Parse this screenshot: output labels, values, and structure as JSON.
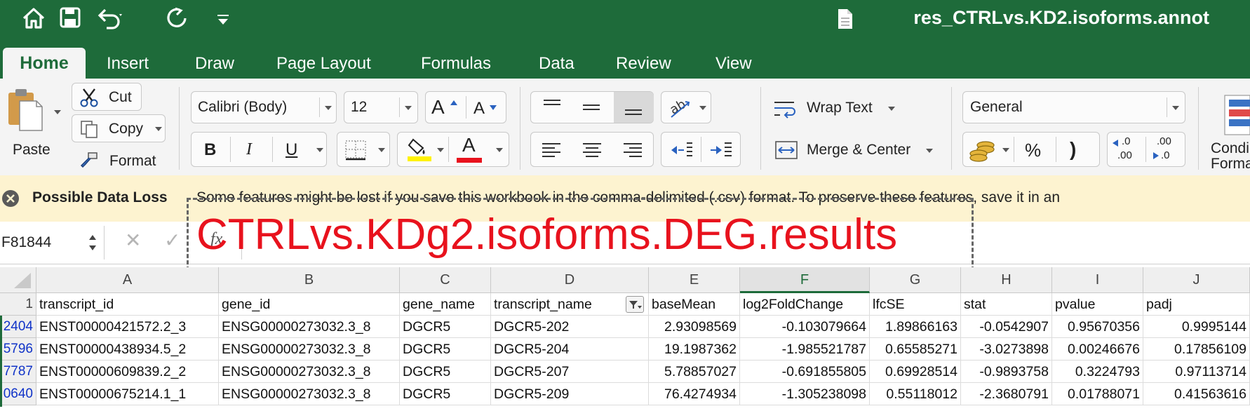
{
  "app": {
    "title": "res_CTRLvs.KD2.isoforms.annot",
    "tabs": [
      "Home",
      "Insert",
      "Draw",
      "Page Layout",
      "Formulas",
      "Data",
      "Review",
      "View"
    ],
    "active_tab": "Home",
    "accent": "#1e6b3a"
  },
  "ribbon": {
    "paste_label": "Paste",
    "cut_label": "Cut",
    "copy_label": "Copy",
    "format_label": "Format",
    "font_name": "Calibri (Body)",
    "font_size": "12",
    "bold": "B",
    "italic": "I",
    "underline": "U",
    "font_grow": "A",
    "font_shrink": "A",
    "font_color_letter": "A",
    "wrap_text_label": "Wrap Text",
    "merge_center_label": "Merge & Center",
    "number_format": "General",
    "percent": "%",
    "comma": ")",
    "inc_decimal": ".00",
    "dec_decimal": ".0",
    "conditional_label_1": "Condi",
    "conditional_label_2": "Forma"
  },
  "warning": {
    "title": "Possible Data Loss",
    "message": "Some features might be lost if you save this workbook in the comma-delimited (.csv) format. To preserve these features, save it in an"
  },
  "formula_bar": {
    "name_box": "F81844",
    "cancel": "✕",
    "confirm": "✓",
    "fx": "fx"
  },
  "overlay": {
    "text": "CTRLvs.KDg2.isoforms.DEG.results",
    "color": "#e8121d"
  },
  "columns": [
    "A",
    "B",
    "C",
    "D",
    "E",
    "F",
    "G",
    "H",
    "I",
    "J"
  ],
  "header_row": {
    "row_label": "1",
    "cells": [
      "transcript_id",
      "gene_id",
      "gene_name",
      "transcript_name",
      "baseMean",
      "log2FoldChange",
      "lfcSE",
      "stat",
      "pvalue",
      "padj"
    ]
  },
  "rows": [
    {
      "row_label": "2404",
      "cells": [
        "ENST00000421572.2_3",
        "ENSG00000273032.3_8",
        "DGCR5",
        "DGCR5-202",
        "2.93098569",
        "-0.103079664",
        "1.89866163",
        "-0.0542907",
        "0.95670356",
        "0.9995144"
      ]
    },
    {
      "row_label": "5796",
      "cells": [
        "ENST00000438934.5_2",
        "ENSG00000273032.3_8",
        "DGCR5",
        "DGCR5-204",
        "19.1987362",
        "-1.985521787",
        "0.65585271",
        "-3.0273898",
        "0.00246676",
        "0.17856109"
      ]
    },
    {
      "row_label": "7787",
      "cells": [
        "ENST00000609839.2_2",
        "ENSG00000273032.3_8",
        "DGCR5",
        "DGCR5-207",
        "5.78857027",
        "-0.691855805",
        "0.69928514",
        "-0.9893758",
        "0.3224793",
        "0.97113714"
      ]
    },
    {
      "row_label": "0640",
      "cells": [
        "ENST00000675214.1_1",
        "ENSG00000273032.3_8",
        "DGCR5",
        "DGCR5-209",
        "76.4274934",
        "-1.305238098",
        "0.55118012",
        "-2.3680791",
        "0.01788071",
        "0.41563616"
      ]
    }
  ]
}
